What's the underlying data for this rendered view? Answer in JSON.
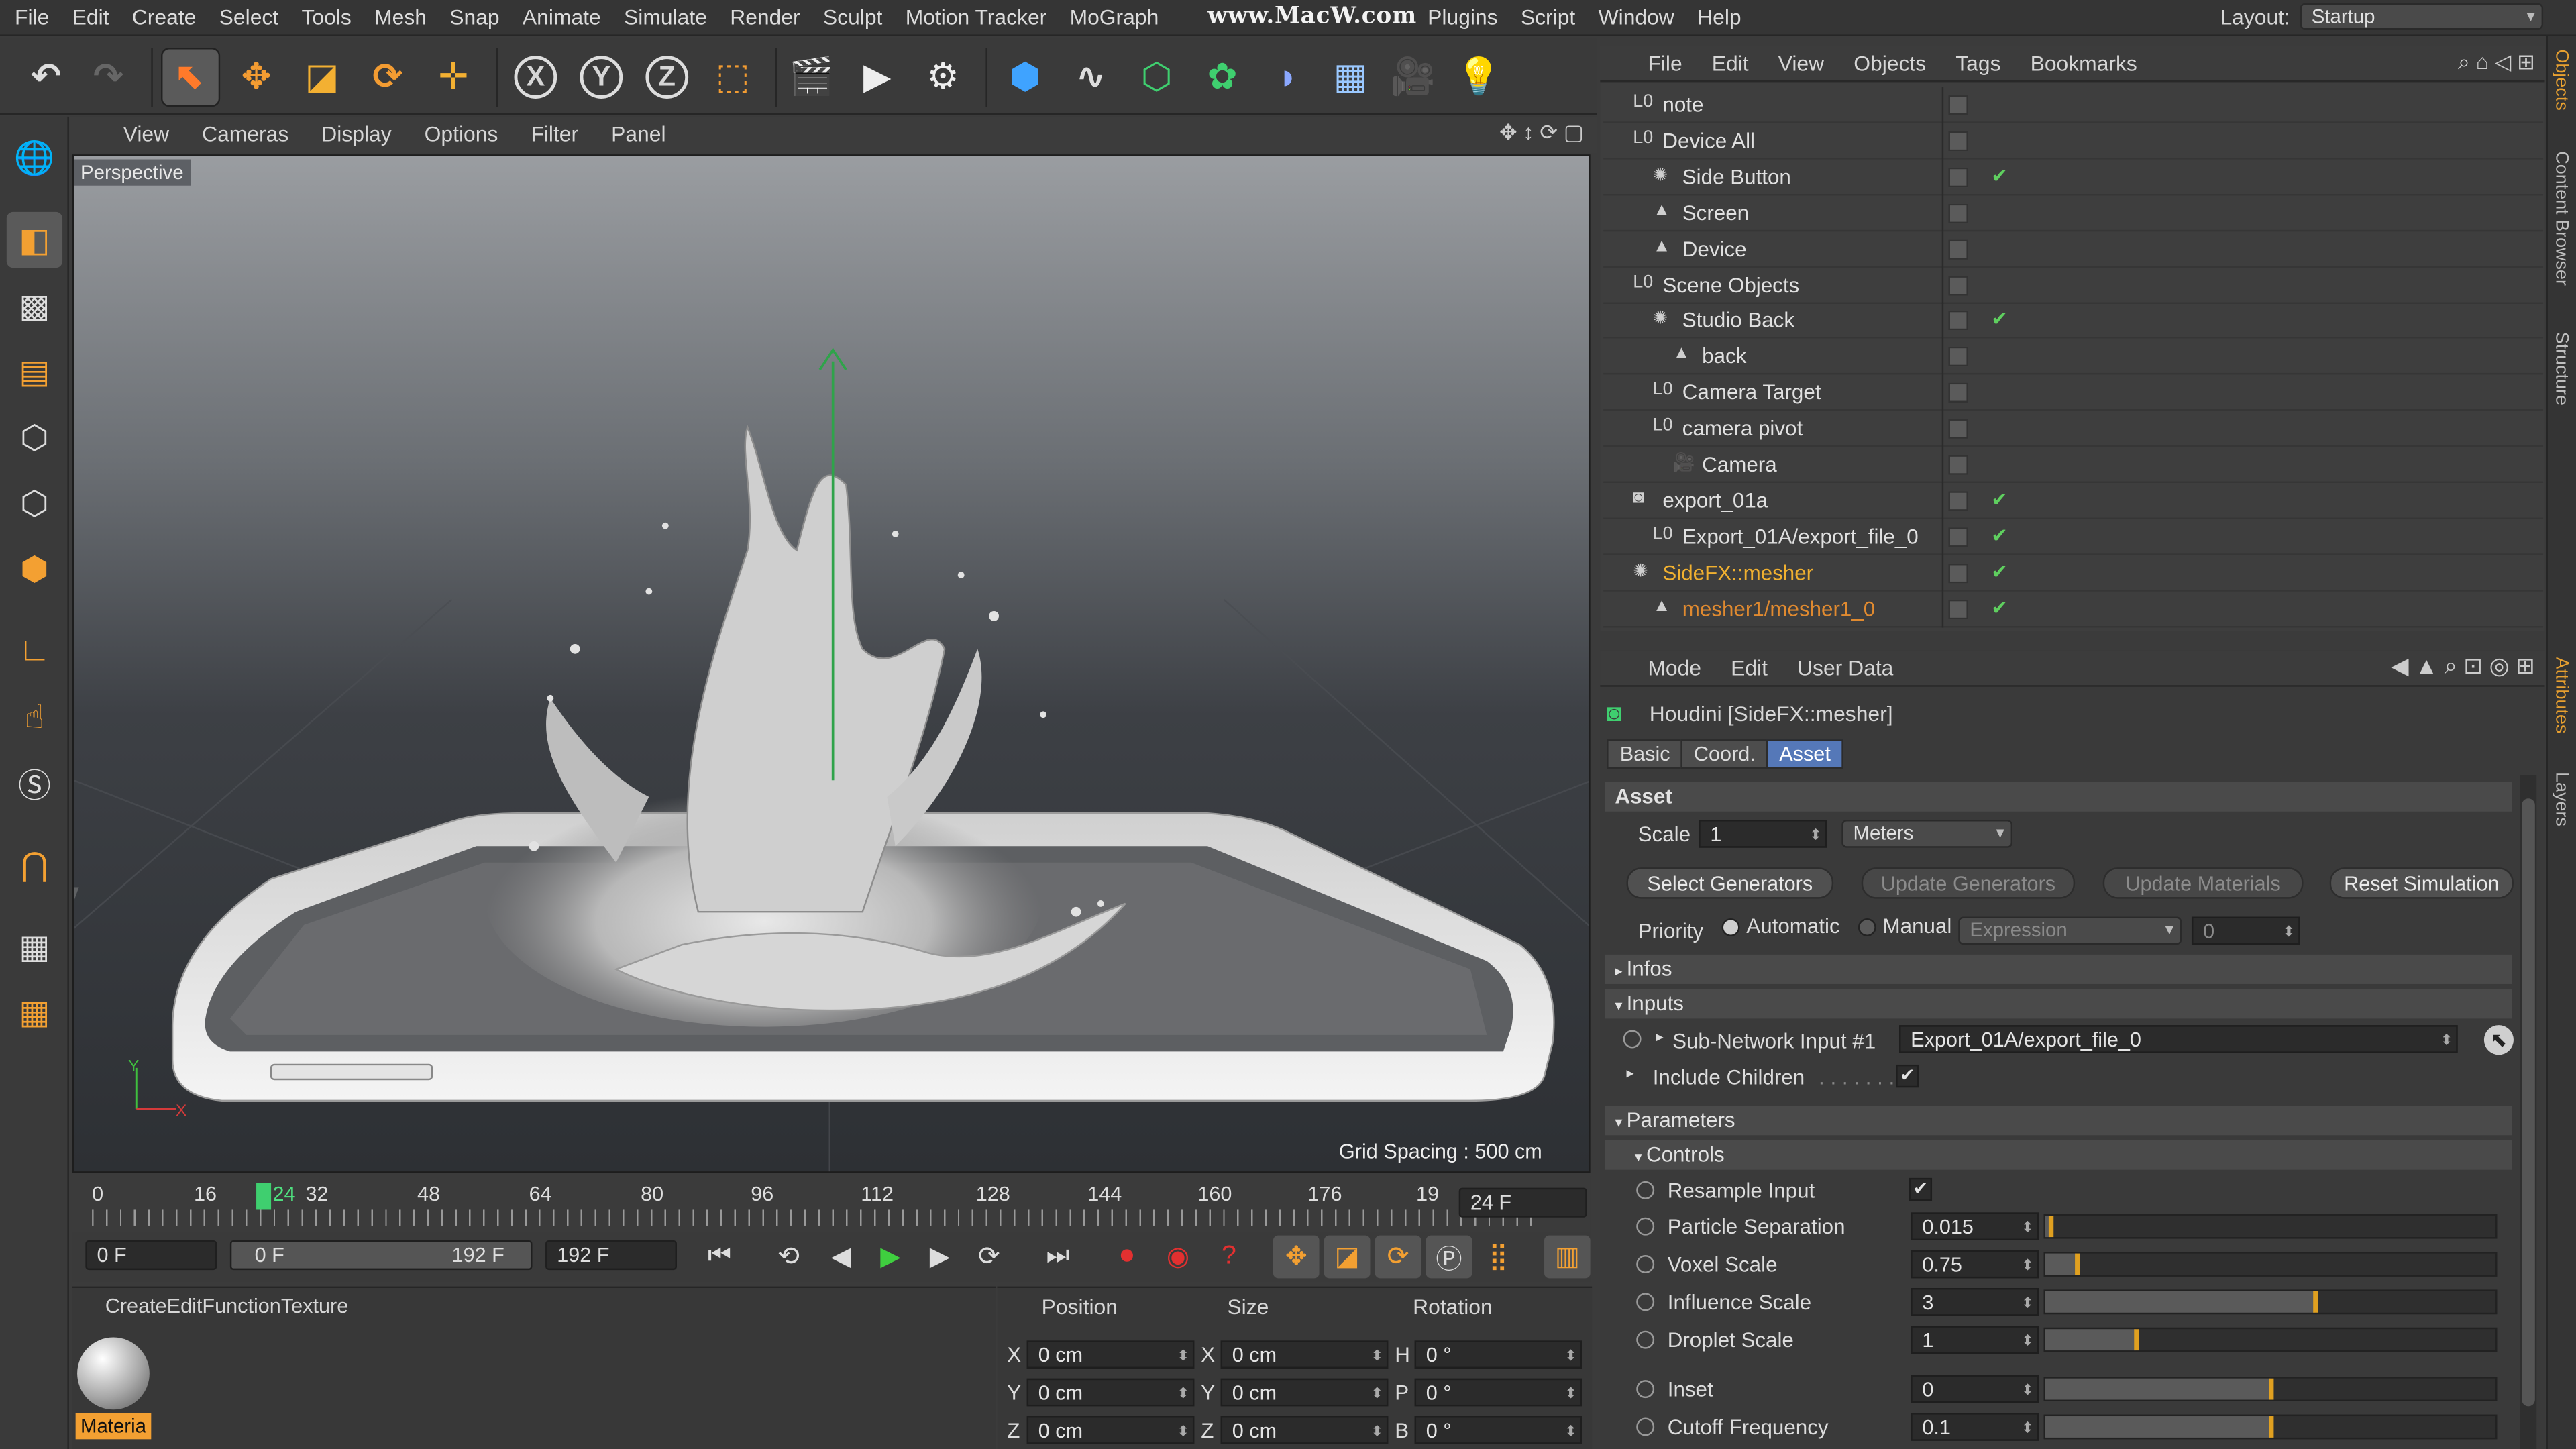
{
  "menubar": {
    "items": [
      "File",
      "Edit",
      "Create",
      "Select",
      "Tools",
      "Mesh",
      "Snap",
      "Animate",
      "Simulate",
      "Render",
      "Sculpt",
      "Motion Tracker",
      "MoGraph"
    ],
    "items_right": [
      "Plugins",
      "Script",
      "Window",
      "Help"
    ],
    "watermark": "www.MacW.com",
    "layout_label": "Layout:",
    "layout_value": "Startup"
  },
  "viewport": {
    "menu": [
      "View",
      "Cameras",
      "Display",
      "Options",
      "Filter",
      "Panel"
    ],
    "label": "Perspective",
    "grid_spacing": "Grid Spacing : 500 cm"
  },
  "timeline": {
    "ticks": [
      "0",
      "16",
      "24",
      "32",
      "48",
      "64",
      "80",
      "96",
      "112",
      "128",
      "144",
      "160",
      "176",
      "19"
    ],
    "current_frame": "24 F",
    "start": "0 F",
    "range_start": "0 F",
    "range_end": "192 F",
    "end": "192 F"
  },
  "material": {
    "menu": [
      "Create",
      "Edit",
      "Function",
      "Texture"
    ],
    "swatch_label": "Materia"
  },
  "coords": {
    "headers": [
      "Position",
      "Size",
      "Rotation"
    ],
    "rows": [
      {
        "a": "X",
        "p": "0 cm",
        "b": "X",
        "s": "0 cm",
        "c": "H",
        "r": "0 °"
      },
      {
        "a": "Y",
        "p": "0 cm",
        "b": "Y",
        "s": "0 cm",
        "c": "P",
        "r": "0 °"
      },
      {
        "a": "Z",
        "p": "0 cm",
        "b": "Z",
        "s": "0 cm",
        "c": "B",
        "r": "0 °"
      }
    ]
  },
  "objects": {
    "menu": [
      "File",
      "Edit",
      "View",
      "Objects",
      "Tags",
      "Bookmarks"
    ],
    "rows": [
      {
        "name": "note",
        "indent": 0,
        "check": false
      },
      {
        "name": "Device All",
        "indent": 0,
        "check": false
      },
      {
        "name": "Side Button",
        "indent": 1,
        "check": true
      },
      {
        "name": "Screen",
        "indent": 1,
        "check": false
      },
      {
        "name": "Device",
        "indent": 1,
        "check": false
      },
      {
        "name": "Scene Objects",
        "indent": 0,
        "check": false
      },
      {
        "name": "Studio Back",
        "indent": 1,
        "check": true
      },
      {
        "name": "back",
        "indent": 2,
        "check": false
      },
      {
        "name": "Camera Target",
        "indent": 1,
        "check": false
      },
      {
        "name": "camera pivot",
        "indent": 1,
        "check": false
      },
      {
        "name": "Camera",
        "indent": 2,
        "check": false
      },
      {
        "name": "export_01a",
        "indent": 0,
        "check": true
      },
      {
        "name": "Export_01A/export_file_0",
        "indent": 1,
        "check": true
      },
      {
        "name": "SideFX::mesher",
        "indent": 0,
        "check": true,
        "highlight": "#f0b030"
      },
      {
        "name": "mesher1/mesher1_0",
        "indent": 1,
        "check": true,
        "highlight": "#e08a30"
      }
    ]
  },
  "attributes": {
    "menu": [
      "Mode",
      "Edit",
      "User Data"
    ],
    "title": "Houdini [SideFX::mesher]",
    "tabs": [
      "Basic",
      "Coord.",
      "Asset"
    ],
    "section_asset": "Asset",
    "scale_label": "Scale",
    "scale_value": "1",
    "units": "Meters",
    "buttons": [
      "Select Generators",
      "Update Generators",
      "Update Materials",
      "Reset Simulation"
    ],
    "priority_label": "Priority",
    "priority_auto": "Automatic",
    "priority_manual": "Manual",
    "priority_expr": "Expression",
    "priority_value": "0",
    "infos": "Infos",
    "inputs": "Inputs",
    "subnet_label": "Sub-Network Input #1",
    "subnet_value": "Export_01A/export_file_0",
    "include_children": "Include Children",
    "parameters": "Parameters",
    "controls": "Controls",
    "params": [
      {
        "label": "Resample Input",
        "kind": "check"
      },
      {
        "label": "Particle Separation",
        "value": "0.015",
        "fill": 0.01
      },
      {
        "label": "Voxel Scale",
        "value": "0.75",
        "fill": 0.07
      },
      {
        "label": "Influence Scale",
        "value": "3",
        "fill": 0.6
      },
      {
        "label": "Droplet Scale",
        "value": "1",
        "fill": 0.2
      },
      {
        "label": "Inset",
        "value": "0",
        "fill": 0.5
      },
      {
        "label": "Cutoff Frequency",
        "value": "0.1",
        "fill": 0.5
      }
    ]
  },
  "right_tabs": [
    "Objects",
    "Content Browser",
    "Structure",
    "Attributes",
    "Layers"
  ]
}
